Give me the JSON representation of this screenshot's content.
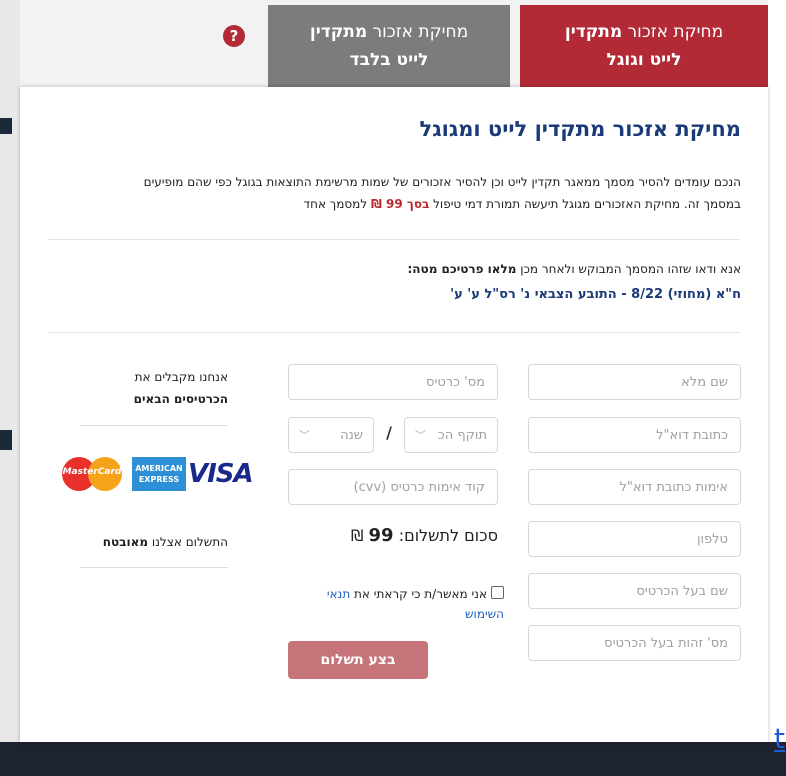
{
  "tabs": [
    {
      "line1_pre": "מחיקת אזכור ",
      "line1_bold": "מתקדין",
      "line2": "לייט וגוגל"
    },
    {
      "line1_pre": "מחיקת אזכור ",
      "line1_bold": "מתקדין",
      "line2": "לייט בלבד"
    }
  ],
  "help_glyph": "?",
  "panel": {
    "title": "מחיקת אזכור מתקדין לייט ומגוגל",
    "intro_line1": "הנכם עומדים להסיר מסמך ממאגר תקדין לייט וכן להסיר אזכורים של שמות מרשימת התוצאות בגוגל כפי שהם מופיעים",
    "intro_line2_pre": "במסמך זה. מחיקת האזכורים מגוגל תיעשה תמורת דמי טיפול ",
    "intro_line2_red": "בסך 99 ₪",
    "intro_line2_post": " למסמך אחד",
    "confirm_pre": "אנא ודאו שזהו המסמך המבוקש ולאחר מכן ",
    "confirm_bold": "מלאו פרטיכם מטה:",
    "case_name": "ח\"א (מחוזי) 8/22 - התובע הצבאי נ' רס\"ל ע' ע'"
  },
  "form": {
    "full_name_ph": "שם מלא",
    "email_ph": "כתובת דוא\"ל",
    "email_confirm_ph": "אימות כתובת דוא\"ל",
    "phone_ph": "טלפון",
    "card_holder_ph": "שם בעל הכרטיס",
    "holder_id_ph": "מס' זהות בעל הכרטיס",
    "card_number_ph": "מס' כרטיס",
    "expiry_month": "תוקף הכ",
    "expiry_year": "שנה",
    "slash": "/",
    "cvv_ph": "קוד אימות כרטיס (cvv)",
    "total_label": "סכום לתשלום:",
    "total_value": "99",
    "currency": "₪",
    "terms_pre": "אני מאשר/ת כי קראתי את ",
    "terms_link": "תנאי השימוש",
    "pay_label": "בצע תשלום"
  },
  "side": {
    "cards_pre": "אנחנו מקבלים את ",
    "cards_bold": "הכרטיסים הבאים",
    "secure_pre": "התשלום אצלנו ",
    "secure_bold": "מאובטח",
    "mastercard": "MasterCard",
    "amex_line1": "AMERICAN",
    "amex_line2": "EXPRESS",
    "visa": "VISA"
  },
  "background": {
    "link_text": "t"
  },
  "colors": {
    "brand_red": "#b22a35",
    "title_blue": "#1a3b78",
    "tab_gray": "#7c7c7c",
    "pay_button": "#c7737a"
  },
  "icons": [
    "help-icon",
    "chevron-down-icon",
    "mastercard-icon",
    "amex-icon",
    "visa-icon"
  ]
}
